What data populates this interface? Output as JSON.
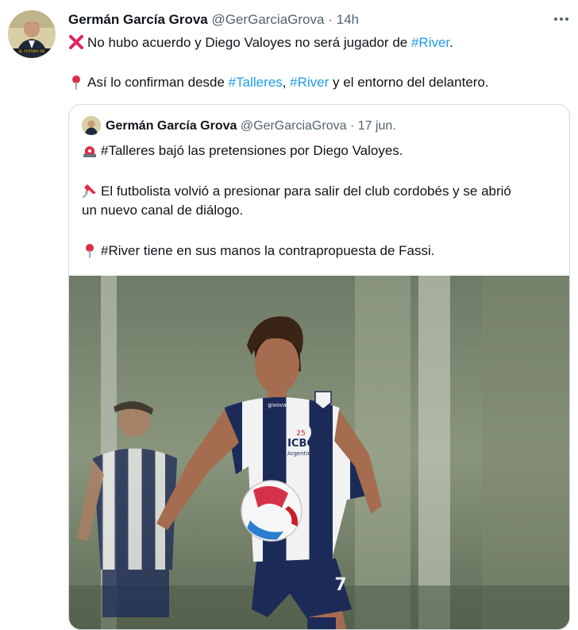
{
  "tweet": {
    "display_name": "Germán García Grova",
    "handle": "@GerGarciaGrova",
    "separator": "·",
    "time": "14h",
    "avatar_caption": "EL FUTURO DE",
    "more_icon": "more-horizontal-icon",
    "line1": {
      "emoji": "cross-mark-icon",
      "text": "No hubo acuerdo y Diego Valoyes no será jugador de",
      "hashtag": "#River",
      "end": "."
    },
    "line2": {
      "emoji": "round-pushpin-icon",
      "text_a": "Así lo confirman desde",
      "hashtag_a": "#Talleres",
      "text_b": ",",
      "hashtag_b": "#River",
      "text_c": "y el entorno del delantero."
    }
  },
  "quote": {
    "display_name": "Germán García Grova",
    "handle": "@GerGarciaGrova",
    "separator": "·",
    "date": "17 jun.",
    "p1": {
      "emoji": "rotating-light-icon",
      "text": "#Talleres bajó las pretensiones por Diego Valoyes."
    },
    "p2": {
      "emoji": "pushpin-icon",
      "line_a": "El futbolista volvió a presionar para salir del club cordobés y se abrió",
      "line_b": "un nuevo canal de diálogo."
    },
    "p3": {
      "emoji": "round-pushpin-icon",
      "text": "#River tiene en sus manos la contrapropuesta de Fassi."
    },
    "photo": {
      "sponsor": "ICBC",
      "sponsor_sub": "Argentina",
      "kit_brand": "givova",
      "shorts_number": "7"
    }
  },
  "colors": {
    "link": "#1d9bf0",
    "muted": "#536471",
    "border": "#cfd9de",
    "kit_navy": "#1c2a58"
  }
}
